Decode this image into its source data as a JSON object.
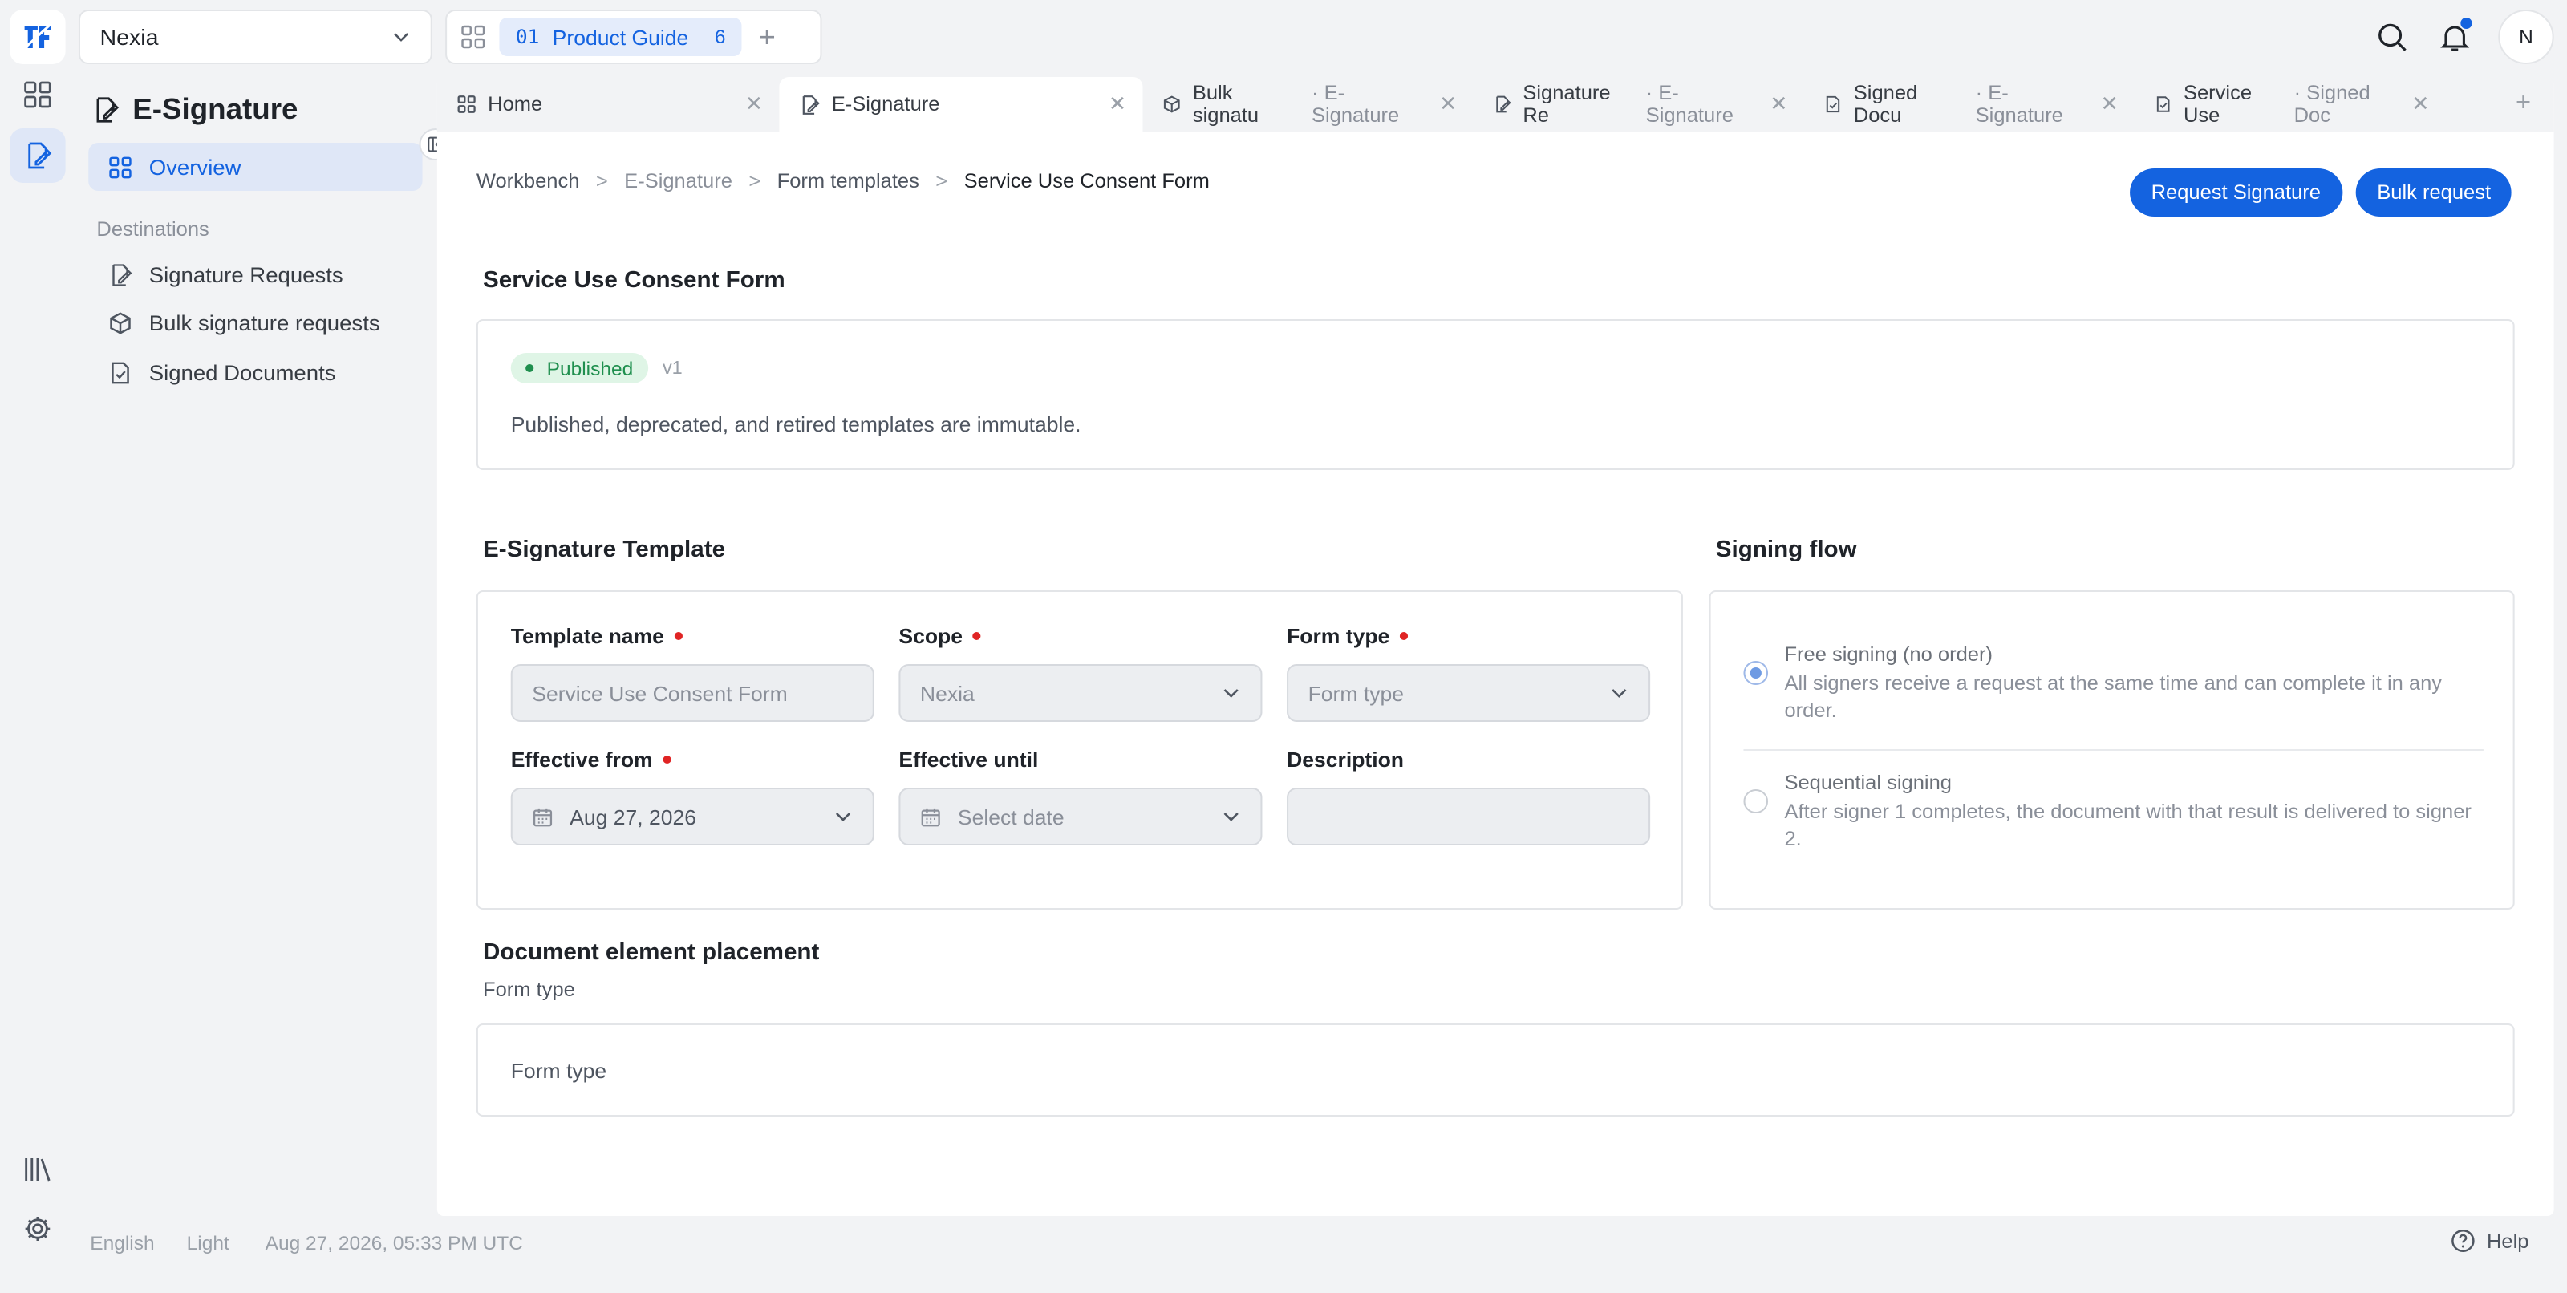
{
  "org": {
    "name": "Nexia"
  },
  "workspace": {
    "number": "01",
    "name": "Product Guide",
    "count": "6"
  },
  "user": {
    "initial": "N"
  },
  "sidebar": {
    "title": "E-Signature",
    "overview": "Overview",
    "section": "Destinations",
    "items": [
      {
        "label": "Signature Requests"
      },
      {
        "label": "Bulk signature requests"
      },
      {
        "label": "Signed Documents"
      }
    ]
  },
  "tabs": [
    {
      "label": "Home",
      "sub": ""
    },
    {
      "label": "E-Signature",
      "sub": ""
    },
    {
      "label": "Bulk signatu",
      "sub": "· E-Signature"
    },
    {
      "label": "Signature Re",
      "sub": "· E-Signature"
    },
    {
      "label": "Signed Docu",
      "sub": "· E-Signature"
    },
    {
      "label": "Service Use",
      "sub": "· Signed Doc"
    }
  ],
  "breadcrumb": [
    "Workbench",
    "E-Signature",
    "Form templates",
    "Service Use Consent Form"
  ],
  "actions": {
    "request": "Request Signature",
    "bulk": "Bulk request"
  },
  "summary": {
    "title": "Service Use Consent Form",
    "status": "Published",
    "version": "v1",
    "note": "Published, deprecated, and retired templates are immutable."
  },
  "template": {
    "heading": "E-Signature Template",
    "fields": {
      "name_label": "Template name",
      "name_value": "Service Use Consent Form",
      "scope_label": "Scope",
      "scope_value": "Nexia",
      "formtype_label": "Form type",
      "formtype_placeholder": "Form type",
      "from_label": "Effective from",
      "from_value": "Aug 27, 2026",
      "until_label": "Effective until",
      "until_placeholder": "Select date",
      "desc_label": "Description",
      "desc_value": ""
    }
  },
  "flow": {
    "heading": "Signing flow",
    "options": [
      {
        "title": "Free signing (no order)",
        "desc": "All signers receive a request at the same time and can complete it in any order.",
        "selected": true
      },
      {
        "title": "Sequential signing",
        "desc": "After signer 1 completes, the document with that result is delivered to signer 2.",
        "selected": false
      }
    ]
  },
  "placement": {
    "heading": "Document element placement",
    "sub": "Form type",
    "box": "Form type"
  },
  "footer": {
    "language": "English",
    "theme": "Light",
    "datetime": "Aug 27, 2026, 05:33 PM UTC",
    "help": "Help"
  },
  "colors": {
    "accent": "#1463e0",
    "success": "#1f8f4e",
    "required": "#e02424"
  }
}
